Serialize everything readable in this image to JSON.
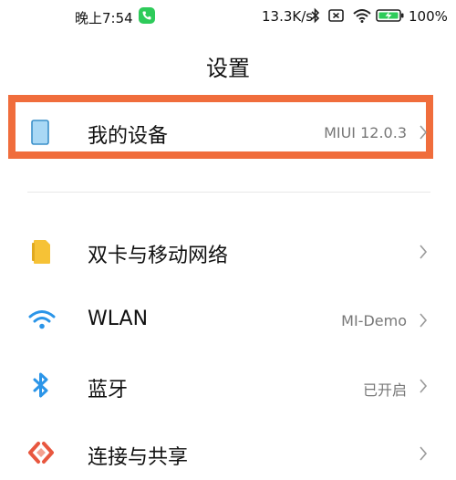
{
  "status_bar": {
    "time": "晚上7:54",
    "speed": "13.3K/s",
    "battery": "100%"
  },
  "page": {
    "title": "设置"
  },
  "rows": [
    {
      "label": "我的设备",
      "value": "MIUI 12.0.3",
      "icon": "device-icon"
    },
    {
      "label": "双卡与移动网络",
      "value": "",
      "icon": "sim-card-icon"
    },
    {
      "label": "WLAN",
      "value": "MI-Demo",
      "icon": "wifi-icon"
    },
    {
      "label": "蓝牙",
      "value": "已开启",
      "icon": "bluetooth-icon"
    },
    {
      "label": "连接与共享",
      "value": "",
      "icon": "share-icon"
    }
  ],
  "colors": {
    "highlight": "#f06d3c",
    "device_icon": "#a9d8f5",
    "sim_icon": "#f6c236",
    "wifi_icon": "#2b95e8",
    "bluetooth_icon": "#2b95e8",
    "share_icon": "#e8573f"
  }
}
